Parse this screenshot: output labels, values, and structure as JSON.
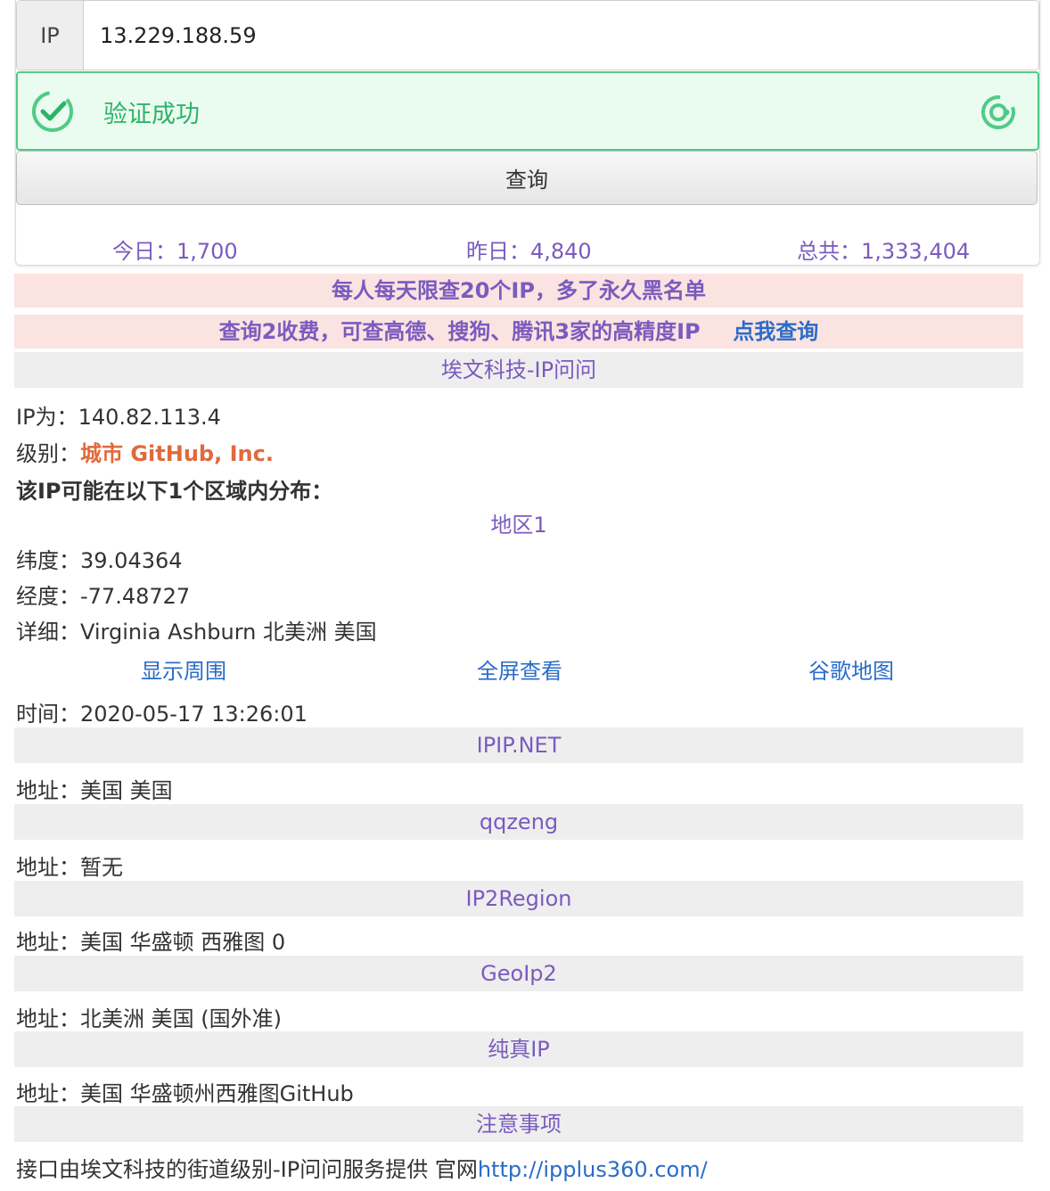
{
  "search": {
    "addon_label": "IP",
    "ip_value": "13.229.188.59",
    "verify_text": "验证成功",
    "query_button": "查询"
  },
  "stats": {
    "today": "今日：1,700",
    "yesterday": "昨日：4,840",
    "total": "总共：1,333,404"
  },
  "notices": {
    "limit": "每人每天限查20个IP，多了永久黑名单",
    "paid": "查询2收费，可查高德、搜狗、腾讯3家的高精度IP",
    "paid_link": "点我查询"
  },
  "sections": {
    "aiwen": "埃文科技-IP问问",
    "ipip": "IPIP.NET",
    "qqzeng": "qqzeng",
    "ip2region": "IP2Region",
    "geoip2": "GeoIp2",
    "chunzhen": "纯真IP",
    "notes": "注意事项"
  },
  "aiwen": {
    "ip_label": "IP为：",
    "ip_value": "140.82.113.4",
    "level_label": "级别：",
    "level_value": "城市 GitHub, Inc.",
    "distribution": "该IP可能在以下1个区域内分布：",
    "region_title": "地区1",
    "lat_label": "纬度：",
    "lat_value": "39.04364",
    "lng_label": "经度：",
    "lng_value": "-77.48727",
    "detail_label": "详细：",
    "detail_value": "Virginia Ashburn 北美洲 美国",
    "map_links": [
      "显示周围",
      "全屏查看",
      "谷歌地图"
    ],
    "time_label": "时间：",
    "time_value": "2020-05-17 13:26:01"
  },
  "addresses": {
    "label": "地址：",
    "ipip": "美国 美国",
    "qqzeng": "暂无",
    "ip2region": "美国 华盛顿 西雅图 0",
    "geoip2": "北美洲 美国 (国外准)",
    "chunzhen": "美国 华盛顿州西雅图GitHub"
  },
  "footer": {
    "text": "接口由埃文科技的街道级别-IP问问服务提供 官网",
    "url": "http://ipplus360.com/"
  },
  "colors": {
    "accent_purple": "#7a5bbf",
    "success_green": "#2eb369",
    "link_blue": "#2a6cc8",
    "level_orange": "#e06a3c"
  }
}
